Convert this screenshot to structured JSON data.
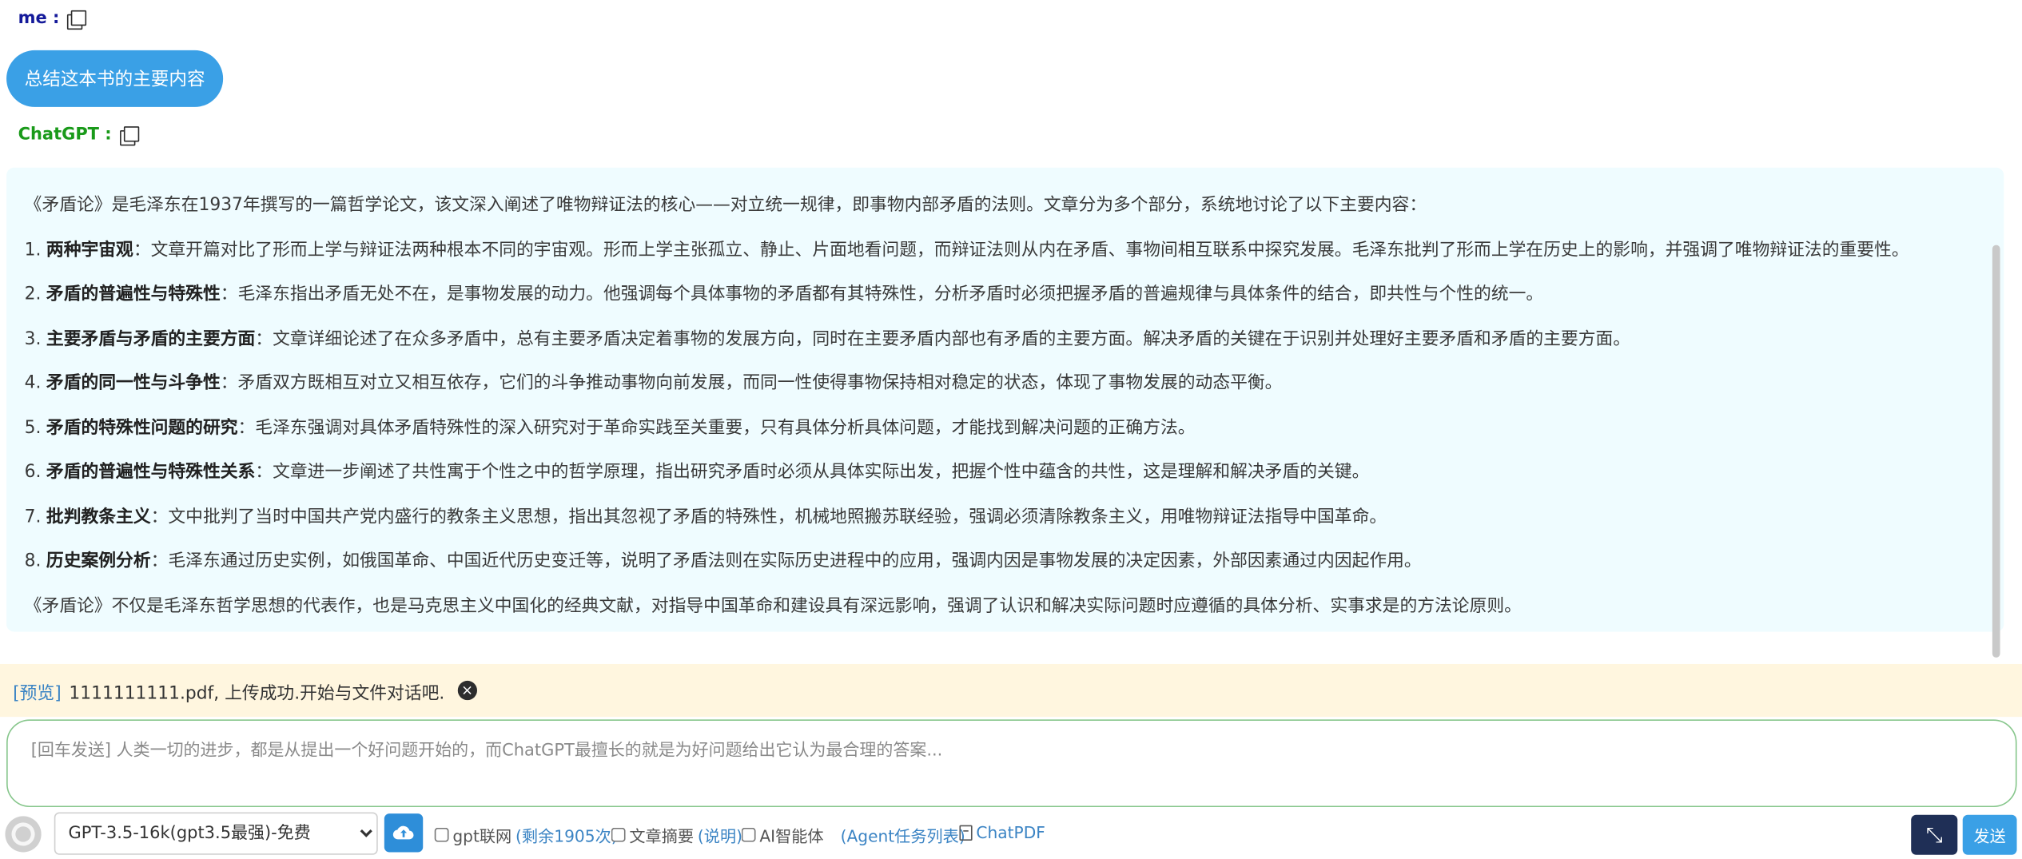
{
  "chat": {
    "me_label": "me :",
    "me_message": "总结这本书的主要内容",
    "gpt_label": "ChatGPT :",
    "answer": {
      "intro": "《矛盾论》是毛泽东在1937年撰写的一篇哲学论文，该文深入阐述了唯物辩证法的核心——对立统一规律，即事物内部矛盾的法则。文章分为多个部分，系统地讨论了以下主要内容：",
      "items": [
        {
          "num": "1.",
          "title": "两种宇宙观",
          "text": "：文章开篇对比了形而上学与辩证法两种根本不同的宇宙观。形而上学主张孤立、静止、片面地看问题，而辩证法则从内在矛盾、事物间相互联系中探究发展。毛泽东批判了形而上学在历史上的影响，并强调了唯物辩证法的重要性。"
        },
        {
          "num": "2.",
          "title": "矛盾的普遍性与特殊性",
          "text": "：毛泽东指出矛盾无处不在，是事物发展的动力。他强调每个具体事物的矛盾都有其特殊性，分析矛盾时必须把握矛盾的普遍规律与具体条件的结合，即共性与个性的统一。"
        },
        {
          "num": "3.",
          "title": "主要矛盾与矛盾的主要方面",
          "text": "：文章详细论述了在众多矛盾中，总有主要矛盾决定着事物的发展方向，同时在主要矛盾内部也有矛盾的主要方面。解决矛盾的关键在于识别并处理好主要矛盾和矛盾的主要方面。"
        },
        {
          "num": "4.",
          "title": "矛盾的同一性与斗争性",
          "text": "：矛盾双方既相互对立又相互依存，它们的斗争推动事物向前发展，而同一性使得事物保持相对稳定的状态，体现了事物发展的动态平衡。"
        },
        {
          "num": "5.",
          "title": "矛盾的特殊性问题的研究",
          "text": "：毛泽东强调对具体矛盾特殊性的深入研究对于革命实践至关重要，只有具体分析具体问题，才能找到解决问题的正确方法。"
        },
        {
          "num": "6.",
          "title": "矛盾的普遍性与特殊性关系",
          "text": "：文章进一步阐述了共性寓于个性之中的哲学原理，指出研究矛盾时必须从具体实际出发，把握个性中蕴含的共性，这是理解和解决矛盾的关键。"
        },
        {
          "num": "7.",
          "title": "批判教条主义",
          "text": "：文中批判了当时中国共产党内盛行的教条主义思想，指出其忽视了矛盾的特殊性，机械地照搬苏联经验，强调必须清除教条主义，用唯物辩证法指导中国革命。"
        },
        {
          "num": "8.",
          "title": "历史案例分析",
          "text": "：毛泽东通过历史实例，如俄国革命、中国近代历史变迁等，说明了矛盾法则在实际历史进程中的应用，强调内因是事物发展的决定因素，外部因素通过内因起作用。"
        }
      ],
      "conclusion": "《矛盾论》不仅是毛泽东哲学思想的代表作，也是马克思主义中国化的经典文献，对指导中国革命和建设具有深远影响，强调了认识和解决实际问题时应遵循的具体分析、实事求是的方法论原则。"
    }
  },
  "notice": {
    "preview_label": "[预览]",
    "message": "1111111111.pdf, 上传成功.开始与文件对话吧."
  },
  "input": {
    "placeholder": "[回车发送] 人类一切的进步，都是从提出一个好问题开始的，而ChatGPT最擅长的就是为好问题给出它认为最合理的答案..."
  },
  "toolbar": {
    "model_selected": "GPT-3.5-16k(gpt3.5最强)-免费",
    "web_label": "gpt联网",
    "web_remaining": "(剩余1905次)",
    "summary_label": "文章摘要",
    "summary_link": "(说明)",
    "agent_label": "AI智能体",
    "agent_link": "(Agent任务列表)",
    "pdf_label": "ChatPDF",
    "send_label": "发送"
  },
  "icons": {
    "copy": "copy-icon",
    "close": "close-icon",
    "upload": "cloud-upload-icon",
    "shrink": "shrink-icon",
    "pdf": "pdf-file-icon",
    "avatar": "avatar"
  }
}
